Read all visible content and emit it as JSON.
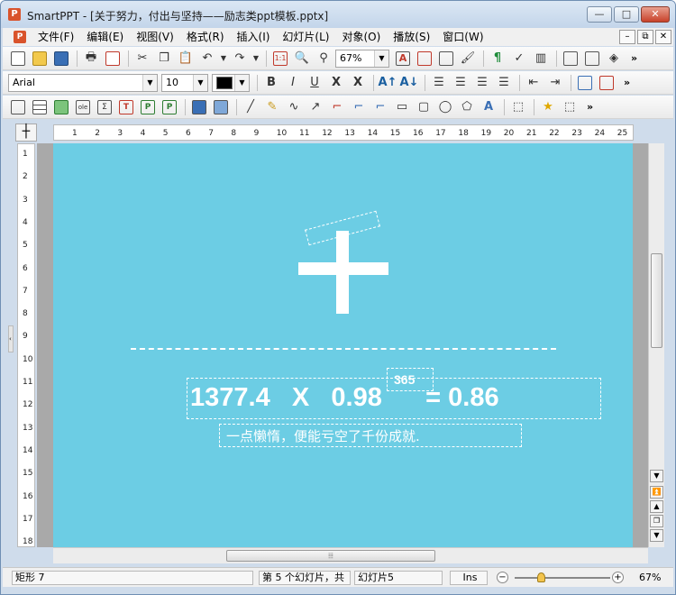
{
  "window": {
    "app_icon": "P",
    "title": "SmartPPT - [关于努力，付出与坚持——励志类ppt模板.pptx]",
    "controls": {
      "minimize": "—",
      "maximize": "□",
      "close": "✕"
    }
  },
  "menubar": {
    "items": [
      "文件(F)",
      "编辑(E)",
      "视图(V)",
      "格式(R)",
      "插入(I)",
      "幻灯片(L)",
      "对象(O)",
      "播放(S)",
      "窗口(W)"
    ],
    "mdi_controls": [
      "–",
      "⧉",
      "✕"
    ]
  },
  "toolbar1": {
    "zoom_value": "67%",
    "more": "»"
  },
  "toolbar2": {
    "font_name": "Arial",
    "font_size": "10",
    "font_color": "#000000",
    "bold": "B",
    "italic": "I",
    "underline": "U",
    "more": "»"
  },
  "toolbar3": {
    "more": "»"
  },
  "ruler": {
    "h_ticks": [
      "1",
      "2",
      "3",
      "4",
      "5",
      "6",
      "7",
      "8",
      "9",
      "10",
      "11",
      "12",
      "13",
      "14",
      "15",
      "16",
      "17",
      "18",
      "19",
      "20",
      "21",
      "22",
      "23",
      "24",
      "25"
    ],
    "v_ticks": [
      "1",
      "2",
      "3",
      "4",
      "5",
      "6",
      "7",
      "8",
      "9",
      "10",
      "11",
      "12",
      "13",
      "14",
      "15",
      "16",
      "17",
      "18"
    ]
  },
  "slide": {
    "background": "#6ccde4",
    "equation": "1377.4   X   0.98      = 0.86",
    "exponent": "365",
    "subtitle": "一点懒惰，便能亏空了千份成就."
  },
  "statusbar": {
    "selection": "矩形 7",
    "slide_position": "第 5 个幻灯片，共",
    "slide_name": "幻灯片5",
    "mode": "Ins",
    "zoom_percent": "67%"
  }
}
